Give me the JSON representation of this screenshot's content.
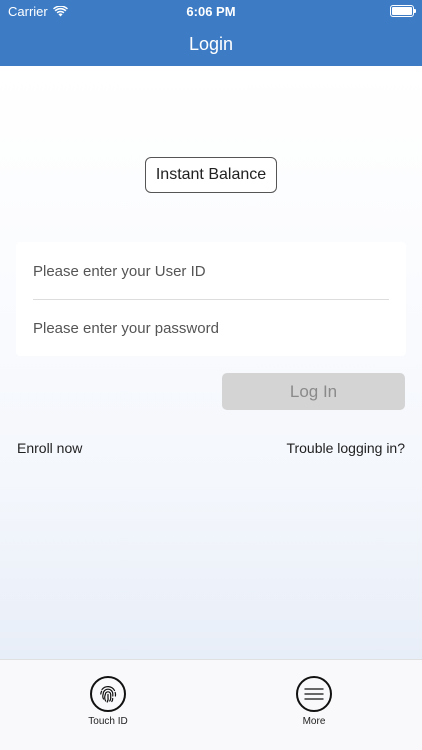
{
  "status_bar": {
    "carrier": "Carrier",
    "time": "6:06 PM"
  },
  "header": {
    "title": "Login"
  },
  "instant_balance": {
    "label": "Instant Balance"
  },
  "form": {
    "user_placeholder": "Please enter your User ID",
    "password_placeholder": "Please enter your password",
    "user_value": "",
    "password_value": ""
  },
  "login_button": {
    "label": "Log In"
  },
  "links": {
    "enroll": "Enroll now",
    "trouble": "Trouble logging in?"
  },
  "tabbar": [
    {
      "label": "Touch ID",
      "icon": "fingerprint-icon"
    },
    {
      "label": "More",
      "icon": "menu-icon"
    }
  ],
  "colors": {
    "header": "#3d7cc5",
    "disabled_button": "#d4d4d4"
  }
}
